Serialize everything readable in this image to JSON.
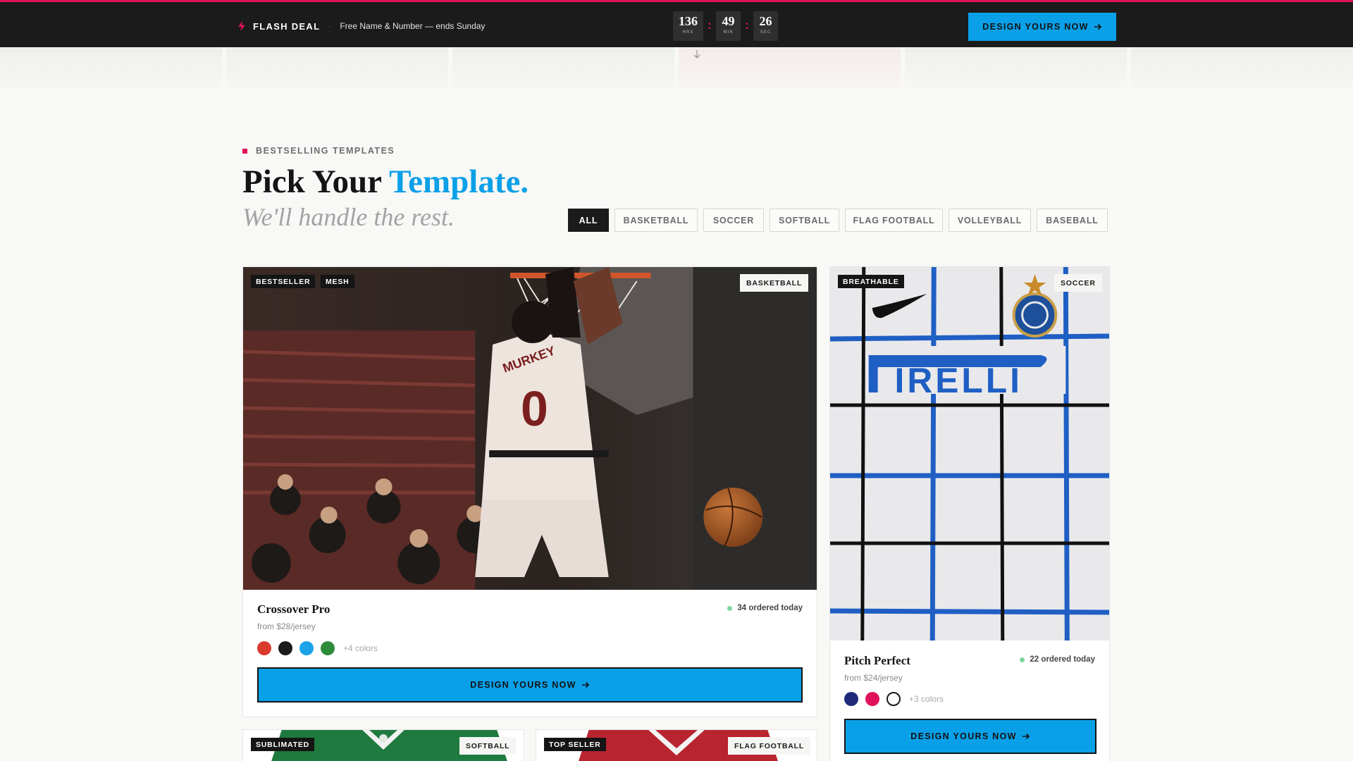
{
  "flash_bar": {
    "label": "FLASH DEAL",
    "separator": "·",
    "text": "Free Name & Number — ends Sunday",
    "countdown": {
      "hours": "136",
      "hours_unit": "HRS",
      "minutes": "49",
      "minutes_unit": "MIN",
      "seconds": "26",
      "seconds_unit": "SEC",
      "colon": ":"
    },
    "cta_label": "DESIGN YOURS NOW"
  },
  "section": {
    "eyebrow": "BESTSELLING TEMPLATES",
    "title_main": "Pick Your",
    "title_accent": "Template.",
    "subtitle": "We'll handle the rest."
  },
  "filters": [
    "ALL",
    "BASKETBALL",
    "SOCCER",
    "SOFTBALL",
    "FLAG FOOTBALL",
    "VOLLEYBALL",
    "BASEBALL"
  ],
  "active_filter": "ALL",
  "cards": {
    "crossover": {
      "tags": [
        "BESTSELLER",
        "MESH"
      ],
      "sport": "BASKETBALL",
      "name": "Crossover Pro",
      "price": "from $28/jersey",
      "ordered": "34 ordered today",
      "swatch_colors": [
        "#d93a2b",
        "#1b1b1b",
        "#1aa3e6",
        "#2e8b3a"
      ],
      "more_colors": "+4 colors",
      "cta_label": "DESIGN YOURS NOW",
      "jersey_lettering": "MURKEY",
      "jersey_number": "0"
    },
    "pitch": {
      "tags": [
        "BREATHABLE"
      ],
      "sport": "SOCCER",
      "name": "Pitch Perfect",
      "price": "from $24/jersey",
      "ordered": "22 ordered today",
      "swatch_colors": [
        "#1f2a7a",
        "#e0125c",
        "#ffffff"
      ],
      "more_colors": "+3 colors",
      "cta_label": "DESIGN YOURS NOW",
      "jersey_sponsor": "IRELLI"
    },
    "softball": {
      "tags": [
        "SUBLIMATED"
      ],
      "sport": "SOFTBALL"
    },
    "flag": {
      "tags": [
        "TOP SELLER"
      ],
      "sport": "FLAG FOOTBALL"
    }
  },
  "colors": {
    "accent": "#0aa0e8",
    "brand_pink": "#e0125c",
    "dark": "#1b1b1b"
  }
}
